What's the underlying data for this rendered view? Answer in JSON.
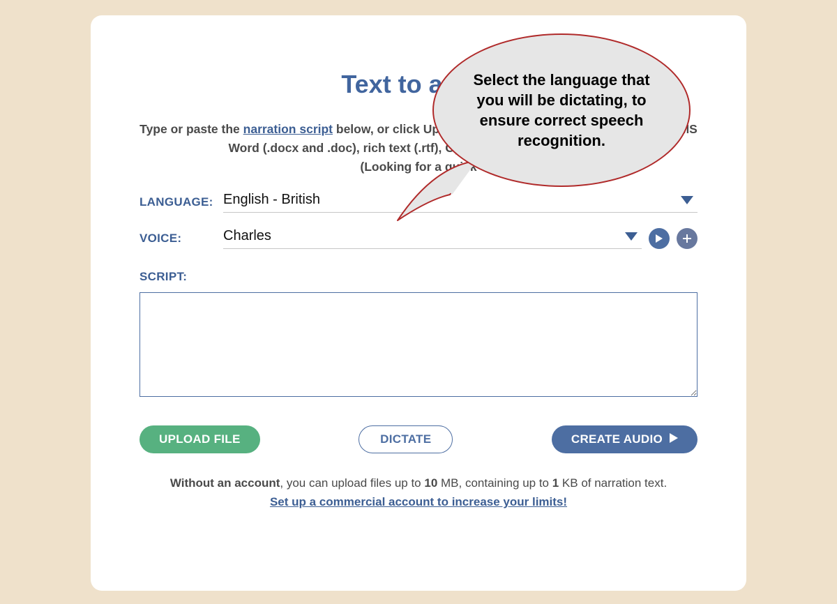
{
  "title": "Text to audio",
  "instructions": {
    "part1": "Type or paste the ",
    "link1": "narration script",
    "part2": " below, or click ",
    "bold1": "Upload File",
    "part3": ". You can upload plain text (.txt), MS Word (.docx and .doc), rich text (.rtf), Open Document (.odt, .ods).",
    "part4_prefix": "(Looking for a quick ",
    "part4_suffix": "?)"
  },
  "language": {
    "label": "LANGUAGE:",
    "value": "English - British"
  },
  "voice": {
    "label": "VOICE:",
    "value": "Charles"
  },
  "script": {
    "label": "SCRIPT:",
    "value": ""
  },
  "buttons": {
    "upload": "UPLOAD FILE",
    "dictate": "DICTATE",
    "create": "CREATE AUDIO"
  },
  "footer": {
    "bold1": "Without an account",
    "part1": ", you can upload files up to ",
    "bold2": "10",
    "part2": " MB, containing up to ",
    "bold3": "1",
    "part3": " KB of narration text.",
    "link": "Set up a commercial account to increase your limits!"
  },
  "tooltip": "Select the language that you will be dictating, to ensure correct speech recognition."
}
